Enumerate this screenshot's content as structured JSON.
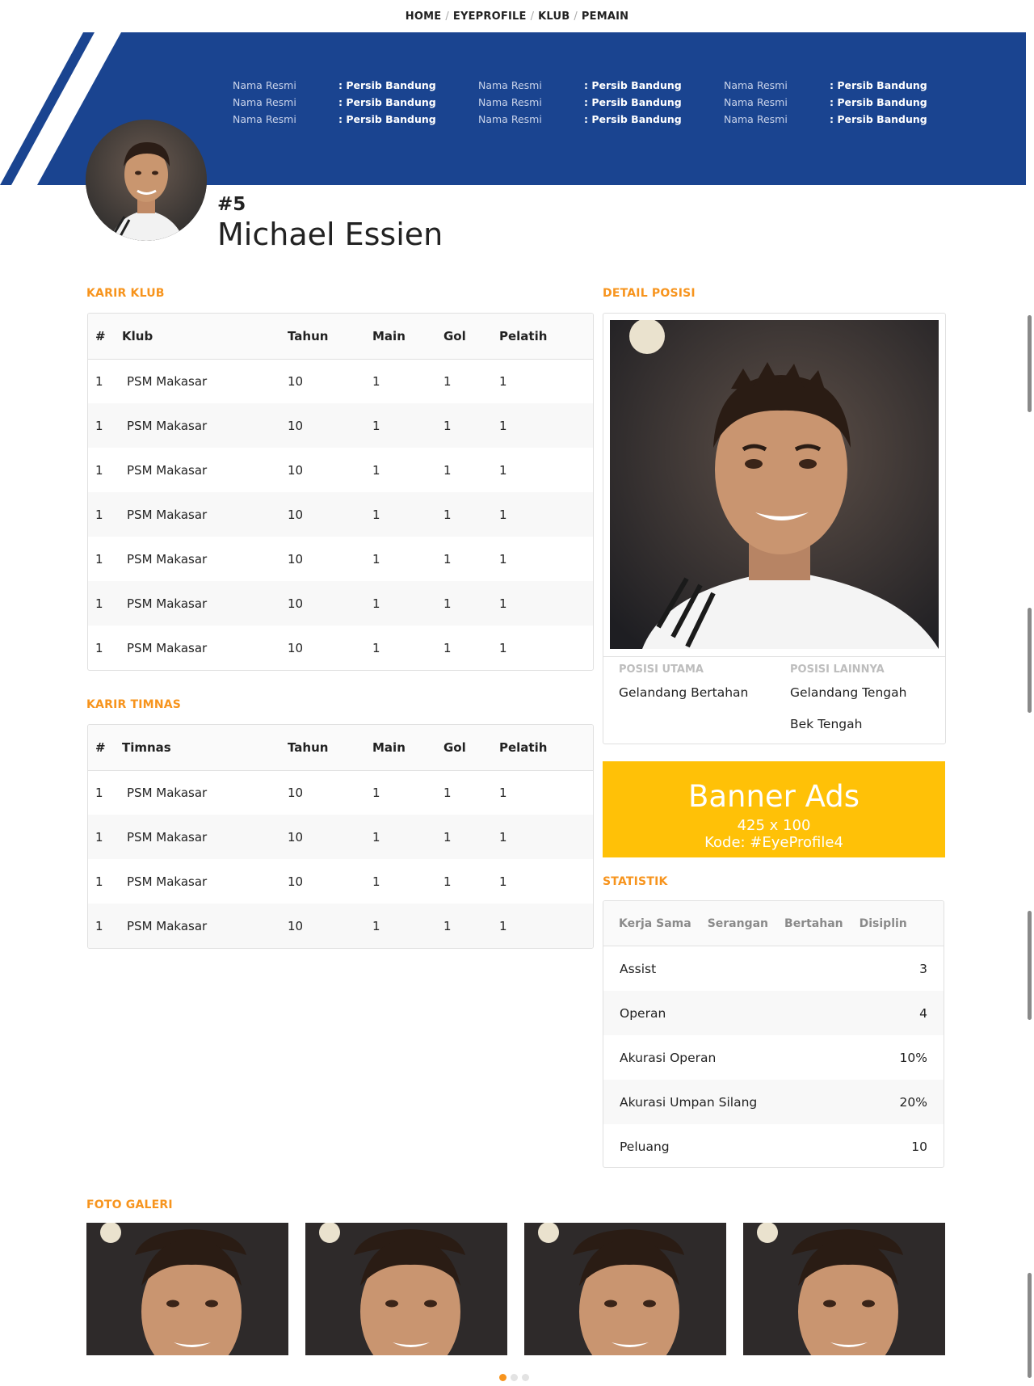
{
  "breadcrumb": [
    "HOME",
    "EYEPROFILE",
    "KLUB",
    "PEMAIN"
  ],
  "hero": {
    "color": "#1a4490",
    "info_columns": [
      [
        {
          "k": "Nama Resmi",
          "v": ": Persib Bandung"
        },
        {
          "k": "Nama Resmi",
          "v": ": Persib Bandung"
        },
        {
          "k": "Nama Resmi",
          "v": ": Persib Bandung"
        }
      ],
      [
        {
          "k": "Nama Resmi",
          "v": ": Persib Bandung"
        },
        {
          "k": "Nama Resmi",
          "v": ": Persib Bandung"
        },
        {
          "k": "Nama Resmi",
          "v": ": Persib Bandung"
        }
      ],
      [
        {
          "k": "Nama Resmi",
          "v": ": Persib Bandung"
        },
        {
          "k": "Nama Resmi",
          "v": ": Persib Bandung"
        },
        {
          "k": "Nama Resmi",
          "v": ": Persib Bandung"
        }
      ]
    ]
  },
  "player": {
    "number": "#5",
    "name": "Michael Essien"
  },
  "karir_klub": {
    "title": "KARIR KLUB",
    "headers": [
      "#",
      "Klub",
      "Tahun",
      "Main",
      "Gol",
      "Pelatih"
    ],
    "rows": [
      [
        "1",
        "PSM Makasar",
        "10",
        "1",
        "1",
        "1"
      ],
      [
        "1",
        "PSM Makasar",
        "10",
        "1",
        "1",
        "1"
      ],
      [
        "1",
        "PSM Makasar",
        "10",
        "1",
        "1",
        "1"
      ],
      [
        "1",
        "PSM Makasar",
        "10",
        "1",
        "1",
        "1"
      ],
      [
        "1",
        "PSM Makasar",
        "10",
        "1",
        "1",
        "1"
      ],
      [
        "1",
        "PSM Makasar",
        "10",
        "1",
        "1",
        "1"
      ],
      [
        "1",
        "PSM Makasar",
        "10",
        "1",
        "1",
        "1"
      ]
    ]
  },
  "karir_timnas": {
    "title": "KARIR TIMNAS",
    "headers": [
      "#",
      "Timnas",
      "Tahun",
      "Main",
      "Gol",
      "Pelatih"
    ],
    "rows": [
      [
        "1",
        "PSM Makasar",
        "10",
        "1",
        "1",
        "1"
      ],
      [
        "1",
        "PSM Makasar",
        "10",
        "1",
        "1",
        "1"
      ],
      [
        "1",
        "PSM Makasar",
        "10",
        "1",
        "1",
        "1"
      ],
      [
        "1",
        "PSM Makasar",
        "10",
        "1",
        "1",
        "1"
      ]
    ]
  },
  "detail_posisi": {
    "title": "DETAIL POSISI",
    "utama_label": "POSISI UTAMA",
    "utama": [
      "Gelandang Bertahan"
    ],
    "lainnya_label": "POSISI LAINNYA",
    "lainnya": [
      "Gelandang Tengah",
      "Bek Tengah"
    ]
  },
  "banner": {
    "title": "Banner Ads",
    "size": "425 x 100",
    "code": "Kode: #EyeProfile4",
    "color": "#ffc107"
  },
  "statistik": {
    "title": "STATISTIK",
    "tabs": [
      "Kerja Sama",
      "Serangan",
      "Bertahan",
      "Disiplin"
    ],
    "rows": [
      {
        "label": "Assist",
        "value": "3"
      },
      {
        "label": "Operan",
        "value": "4"
      },
      {
        "label": "Akurasi Operan",
        "value": "10%"
      },
      {
        "label": "Akurasi Umpan Silang",
        "value": "20%"
      },
      {
        "label": "Peluang",
        "value": "10"
      }
    ]
  },
  "galeri": {
    "title": "FOTO GALERI",
    "count": 4,
    "dots": 3,
    "active_dot": 0
  },
  "accent_color": "#f7941d"
}
